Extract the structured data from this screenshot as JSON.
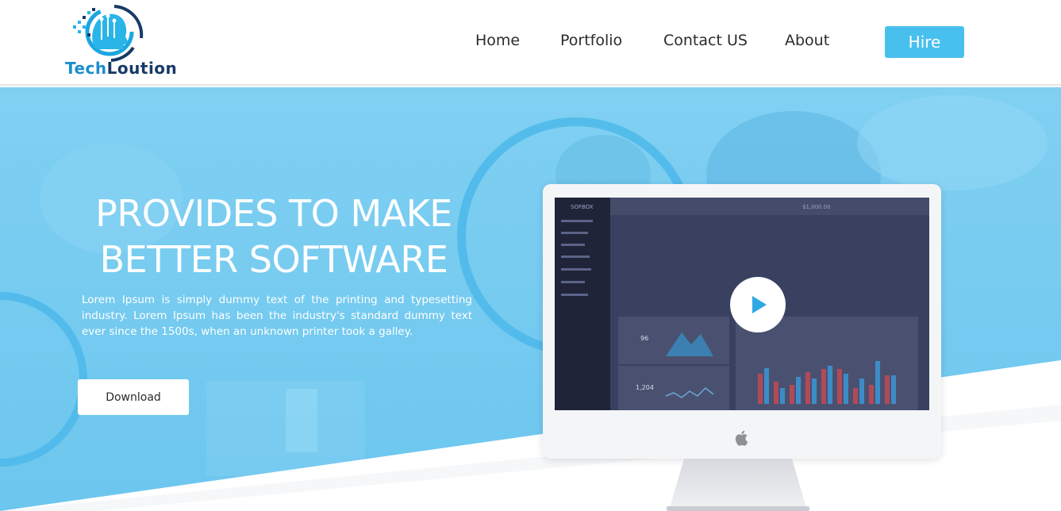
{
  "brand": {
    "name_part1": "Tech",
    "name_part2": "Loution"
  },
  "nav": {
    "items": [
      {
        "label": "Home"
      },
      {
        "label": "Portfolio"
      },
      {
        "label": "Contact US"
      },
      {
        "label": "About"
      }
    ],
    "cta_label": "Hire"
  },
  "hero": {
    "headline_line1": "PROVIDES TO MAKE",
    "headline_line2": "BETTER SOFTWARE",
    "lead": "Lorem Ipsum is simply dummy text of the printing and typesetting industry. Lorem Ipsum has been the industry's standard dummy text ever since the 1500s, when an unknown printer took a galley.",
    "download_label": "Download"
  },
  "dashboard_preview": {
    "brand": "SOFBOX",
    "balance": "$1,000.00",
    "stat1_value": "96",
    "stat2_value": "1,204"
  },
  "colors": {
    "accent": "#48c0ee",
    "hero_bg": "#72c9ef",
    "ring": "#4fb9ea",
    "logo_blue": "#1a8ed0",
    "logo_dark": "#173a66"
  },
  "icons": {
    "logo": "head-circuit-logo-icon",
    "play": "play-icon",
    "apple": "apple-logo-icon"
  }
}
